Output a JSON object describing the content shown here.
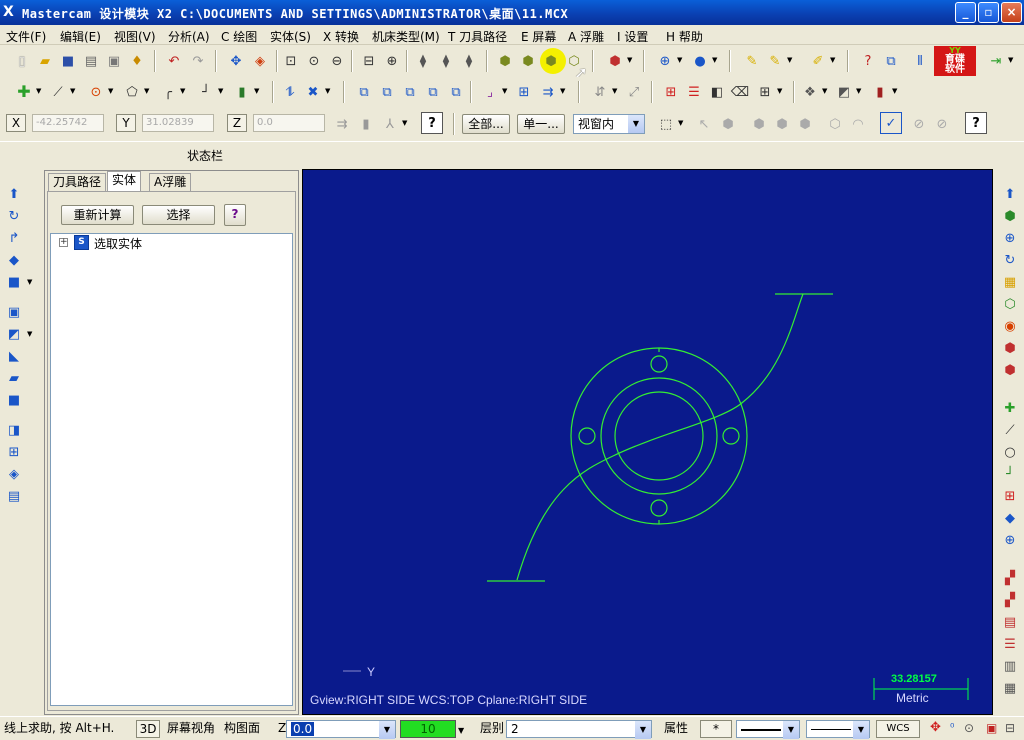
{
  "titlebar": {
    "app_icon": "X",
    "title": "Mastercam 设计模块  X2  C:\\DOCUMENTS AND SETTINGS\\ADMINISTRATOR\\桌面\\11.MCX",
    "minimize": "_",
    "maximize": "▫",
    "close": "×"
  },
  "menu": [
    {
      "label": "文件(F)"
    },
    {
      "label": "编辑(E)"
    },
    {
      "label": "视图(V)"
    },
    {
      "label": "分析(A)"
    },
    {
      "label": "C 绘图"
    },
    {
      "label": "实体(S)"
    },
    {
      "label": "X 转换"
    },
    {
      "label": "机床类型(M)"
    },
    {
      "label": "T 刀具路径"
    },
    {
      "label": "E 屏幕"
    },
    {
      "label": "A 浮雕"
    },
    {
      "label": "I 设置"
    },
    {
      "label": "H 帮助"
    }
  ],
  "logo": {
    "top": "YY",
    "line1": "育碟",
    "line2": "软件"
  },
  "coordbar": {
    "x_label": "X",
    "x_value": "-42.25742",
    "y_label": "Y",
    "y_value": "31.02839",
    "z_label": "Z",
    "z_value": "0.0",
    "all_button": "全部...",
    "single_button": "单一...",
    "window_select": "视窗内"
  },
  "statusrow": {
    "label": "状态栏"
  },
  "panel": {
    "tabs": [
      {
        "label": "刀具路径"
      },
      {
        "label": "实体"
      },
      {
        "label": "A浮雕"
      }
    ],
    "recalc_button": "重新计算",
    "select_button": "选择",
    "help_button": "?",
    "tree_item": "选取实体",
    "tree_expander": "+",
    "tree_icon_letter": "S"
  },
  "viewport": {
    "background": "#0a1a8c",
    "geometry_color": "#33ee33",
    "axis_label": "Y",
    "view_info": "Gview:RIGHT SIDE   WCS:TOP   Cplane:RIGHT SIDE",
    "scale_value": "33.28157",
    "scale_unit": "Metric"
  },
  "bottombar": {
    "help_text": "线上求助, 按 Alt+H.",
    "mode_3d": "3D",
    "screen_view": "屏幕视角",
    "construct_plane": "构图面",
    "z_label": "Z",
    "z_value": "0.0",
    "color_value": "10",
    "level_label": "层别",
    "level_value": "2",
    "attributes": "属性",
    "wcs": "WCS"
  }
}
